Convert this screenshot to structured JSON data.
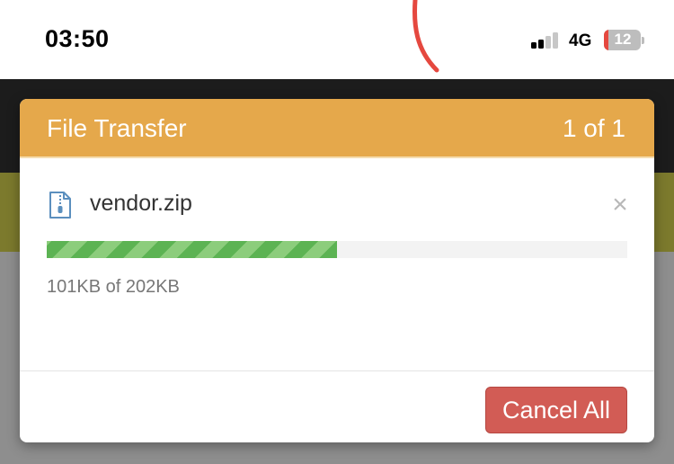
{
  "status_bar": {
    "time": "03:50",
    "network": "4G",
    "battery_level": "12"
  },
  "modal": {
    "title": "File Transfer",
    "counter": "1 of 1",
    "header_color": "#e5a84b",
    "file": {
      "name": "vendor.zip",
      "icon": "zip-file-icon",
      "progress_text": "101KB of 202KB",
      "progress_fraction": 0.5,
      "progress_color": "#74be66"
    },
    "remove_icon": "×",
    "cancel_label": "Cancel All",
    "cancel_color": "#d25c55"
  }
}
